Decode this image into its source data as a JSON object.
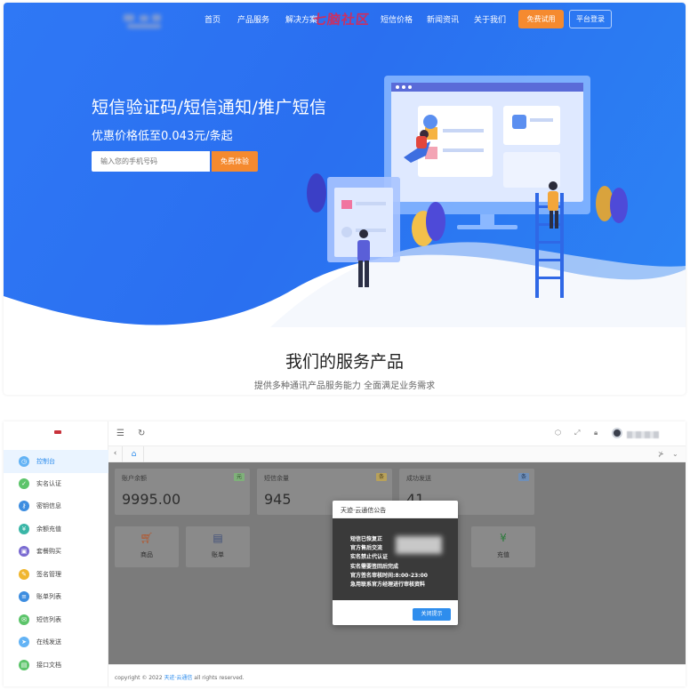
{
  "landing": {
    "nav": {
      "items": [
        "首页",
        "产品服务",
        "解决方案",
        "",
        "短信价格",
        "新闻资讯",
        "关于我们"
      ],
      "watermark": "七脑社区",
      "free_trial_label": "免费试用",
      "login_label": "平台登录"
    },
    "hero": {
      "title": "短信验证码/短信通知/推广短信",
      "subtitle": "优惠价格低至0.043元/条起",
      "phone_placeholder": "输入您的手机号码",
      "free_experience_label": "免费体验"
    },
    "services": {
      "title": "我们的服务产品",
      "subtitle": "提供多种通讯产品服务能力 全面满足业务需求"
    },
    "colors": {
      "hero_blue": "#2f78f5",
      "accent_orange": "#f58a2f"
    }
  },
  "admin": {
    "sidebar": {
      "items": [
        {
          "label": "控制台",
          "icon": "dashboard-icon",
          "color": "#63b3f5"
        },
        {
          "label": "实名认证",
          "icon": "verify-icon",
          "color": "#5cc46a"
        },
        {
          "label": "密钥信息",
          "icon": "key-icon",
          "color": "#3d8de0"
        },
        {
          "label": "余额充值",
          "icon": "recharge-icon",
          "color": "#3ab6a7"
        },
        {
          "label": "套餐购买",
          "icon": "package-icon",
          "color": "#7a6bd1"
        },
        {
          "label": "签名管理",
          "icon": "signature-icon",
          "color": "#f0b62f"
        },
        {
          "label": "账单列表",
          "icon": "bill-icon",
          "color": "#3d8de0"
        },
        {
          "label": "短信列表",
          "icon": "sms-icon",
          "color": "#5cc46a"
        },
        {
          "label": "在线发送",
          "icon": "send-icon",
          "color": "#63b3f5"
        },
        {
          "label": "接口文档",
          "icon": "doc-icon",
          "color": "#5cc46a"
        }
      ]
    },
    "cards": [
      {
        "label": "账户余额",
        "badge": "元",
        "value": "9995.00",
        "badge_color": "#7fb07a"
      },
      {
        "label": "短信余量",
        "badge": "条",
        "value": "945",
        "badge_color": "#b8a15a"
      },
      {
        "label": "成功发送",
        "badge": "条",
        "value": "41",
        "badge_color": "#6f8fb8"
      }
    ],
    "quick_links": [
      {
        "label": "商品",
        "icon": "cart-icon"
      },
      {
        "label": "账单",
        "icon": "bill-icon"
      },
      {
        "label": "充值",
        "icon": "yen-icon"
      }
    ],
    "modal": {
      "title": "天迹·云通信公告",
      "lines": [
        "短信已恢复正",
        "官方售后交流",
        "实名禁止代认证",
        "实名需要签回后完成",
        "官方签名审核时间:8:00-23:00",
        "急用联系官方经理进行审核资料"
      ],
      "close_label": "关闭提示"
    },
    "footer": {
      "prefix": "copyright © 2022",
      "link": "天迹·云通信",
      "suffix": "all rights reserved."
    }
  }
}
